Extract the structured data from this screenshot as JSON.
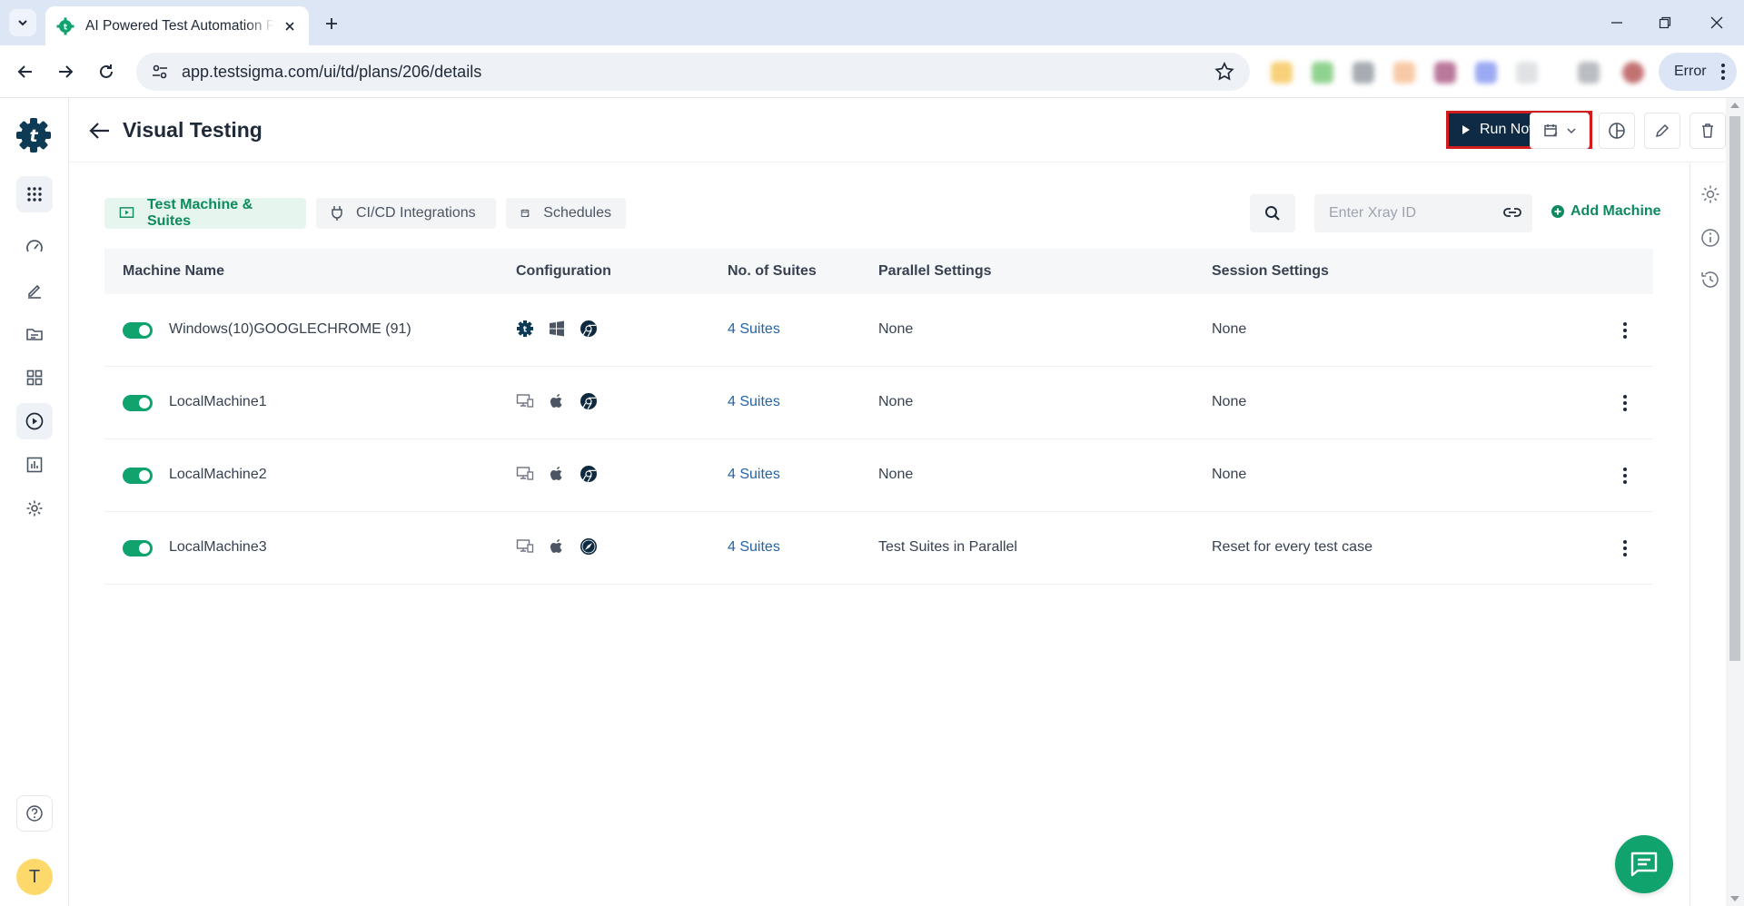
{
  "browser": {
    "tab_title": "AI Powered Test Automation Platform",
    "url": "app.testsigma.com/ui/td/plans/206/details",
    "profile_button": "Error"
  },
  "header": {
    "title": "Visual Testing",
    "run_now_label": "Run Now"
  },
  "user": {
    "avatar_initial": "T"
  },
  "tabs": [
    {
      "label": "Test Machine & Suites",
      "active": true
    },
    {
      "label": "CI/CD Integrations",
      "active": false
    },
    {
      "label": "Schedules",
      "active": false
    }
  ],
  "toolbar": {
    "xray_placeholder": "Enter Xray ID",
    "add_machine_label": "Add Machine"
  },
  "table": {
    "columns": [
      "Machine Name",
      "Configuration",
      "No. of Suites",
      "Parallel Settings",
      "Session Settings"
    ],
    "rows": [
      {
        "enabled": true,
        "name": "Windows(10)GOOGLECHROME (91)",
        "config_icons": [
          "testsigma-cloud-icon",
          "windows-icon",
          "chrome-icon"
        ],
        "suites": "4 Suites",
        "parallel": "None",
        "session": "None"
      },
      {
        "enabled": true,
        "name": "LocalMachine1",
        "config_icons": [
          "local-machine-icon",
          "apple-icon",
          "chrome-icon"
        ],
        "suites": "4 Suites",
        "parallel": "None",
        "session": "None"
      },
      {
        "enabled": true,
        "name": "LocalMachine2",
        "config_icons": [
          "local-machine-icon",
          "apple-icon",
          "chrome-icon"
        ],
        "suites": "4 Suites",
        "parallel": "None",
        "session": "None"
      },
      {
        "enabled": true,
        "name": "LocalMachine3",
        "config_icons": [
          "local-machine-icon",
          "apple-icon",
          "safari-icon"
        ],
        "suites": "4 Suites",
        "parallel": "Test Suites in Parallel",
        "session": "Reset for every test case"
      }
    ]
  },
  "colors": {
    "brand_green": "#10a36d",
    "run_now_bg": "#0f2a45",
    "highlight_border": "#d11d1d",
    "link_blue": "#2563a6"
  }
}
